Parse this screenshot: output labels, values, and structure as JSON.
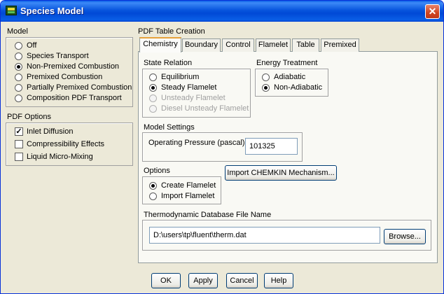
{
  "window": {
    "title": "Species Model"
  },
  "model": {
    "label": "Model",
    "options": [
      "Off",
      "Species Transport",
      "Non-Premixed Combustion",
      "Premixed Combustion",
      "Partially Premixed Combustion",
      "Composition PDF Transport"
    ],
    "selected": "Non-Premixed Combustion"
  },
  "pdf_options": {
    "label": "PDF Options",
    "items": [
      {
        "label": "Inlet Diffusion",
        "checked": true
      },
      {
        "label": "Compressibility Effects",
        "checked": false
      },
      {
        "label": "Liquid Micro-Mixing",
        "checked": false
      }
    ]
  },
  "pdf_table": {
    "label": "PDF Table Creation",
    "tabs": [
      "Chemistry",
      "Boundary",
      "Control",
      "Flamelet",
      "Table",
      "Premixed"
    ],
    "active_tab": "Chemistry"
  },
  "state_relation": {
    "label": "State Relation",
    "options": [
      "Equilibrium",
      "Steady Flamelet",
      "Unsteady Flamelet",
      "Diesel Unsteady Flamelet"
    ],
    "selected": "Steady Flamelet",
    "disabled": [
      "Unsteady Flamelet",
      "Diesel Unsteady Flamelet"
    ]
  },
  "energy_treatment": {
    "label": "Energy Treatment",
    "options": [
      "Adiabatic",
      "Non-Adiabatic"
    ],
    "selected": "Non-Adiabatic"
  },
  "model_settings": {
    "label": "Model Settings",
    "operating_pressure_label": "Operating Pressure (pascal)",
    "operating_pressure_value": "101325"
  },
  "options": {
    "label": "Options",
    "choices": [
      "Create Flamelet",
      "Import Flamelet"
    ],
    "selected": "Create Flamelet",
    "import_button": "Import CHEMKIN Mechanism..."
  },
  "thermo_db": {
    "label": "Thermodynamic Database File Name",
    "value": "D:\\users\\tp\\fluent\\therm.dat",
    "browse_button": "Browse..."
  },
  "footer": {
    "ok": "OK",
    "apply": "Apply",
    "cancel": "Cancel",
    "help": "Help"
  },
  "colors": {
    "titlebar": "#0855dd",
    "dialog_bg": "#ece9d8",
    "active_tab_accent": "#e6a23c",
    "close_button": "#cf4420"
  }
}
